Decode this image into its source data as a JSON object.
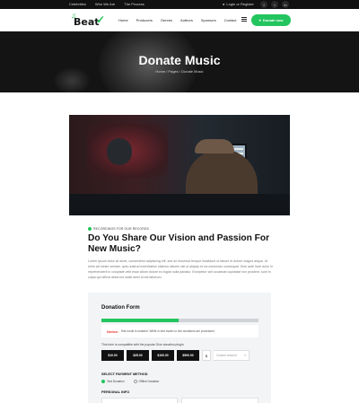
{
  "topbar": {
    "links": [
      "Celebrities",
      "Who We Are",
      "The Process"
    ],
    "login": "Login or Register",
    "social": [
      "f",
      "t",
      "in"
    ]
  },
  "header": {
    "logo_text": "Beat",
    "nav": [
      "Home",
      "Producers",
      "Genres",
      "Authors",
      "Sponsors",
      "Contact"
    ],
    "donate_button": "Donate now"
  },
  "hero": {
    "title": "Donate Music",
    "breadcrumb": "Home  /  Pages  /  Donate Music"
  },
  "article": {
    "tag": "RECORDINGS FOR OUR RECORDS",
    "title": "Do You Share Our Vision and Passion For New Music?",
    "body": "Lorem ipsum dolor sit amet, consectetur adipiscing elit, sed do eiusmod tempor incididunt ut labore et dolore magna aliqua. Ut enim ad minim veniam, quis nostrud exercitation ullamco laboris nisi ut aliquip ex ea commodo consequat. Duis aute irure dolor in reprehenderit in voluptate velit esse cillum dolore eu fugiat nulla pariatur. Excepteur sint occaecat cupidatat non proident, sunt in culpa qui officia deserunt mollit anim id est laborum."
  },
  "donation_form": {
    "title": "Donation Form",
    "progress": 0.49,
    "notice_label": "Notice:",
    "notice_text": "Test mode is enabled. While in test mode no live donations are processed.",
    "amount_hint": "This form is compatible with the popular Give donation plugin",
    "amounts": [
      "$10.00",
      "$25.00",
      "$100.00",
      "$500.00"
    ],
    "currency": "$",
    "custom_placeholder": "Custom Amount",
    "payment_label": "SELECT PAYMENT METHOD",
    "payment_options": [
      "Test Donation",
      "Offline Donation"
    ],
    "personal_label": "PERSONAL INFO"
  },
  "colors": {
    "accent": "#22c55e",
    "dark": "#111111",
    "card_bg": "#f3f4f6"
  }
}
